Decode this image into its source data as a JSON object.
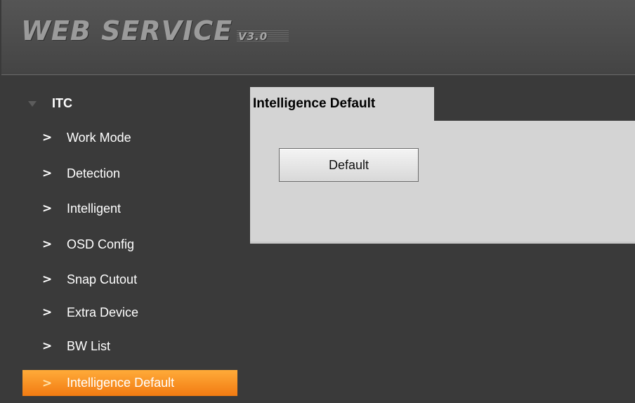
{
  "header": {
    "logo_text": "WEB SERVICE",
    "logo_version": "V3.0"
  },
  "sidebar": {
    "group_label": "ITC",
    "items": [
      {
        "label": "Work Mode",
        "icon": "chevron-right-icon"
      },
      {
        "label": "Detection",
        "icon": "chevron-right-icon"
      },
      {
        "label": "Intelligent",
        "icon": "chevron-right-icon"
      },
      {
        "label": "OSD Config",
        "icon": "chevron-right-icon"
      },
      {
        "label": "Snap Cutout",
        "icon": "chevron-right-icon"
      },
      {
        "label": "Extra Device",
        "icon": "chevron-right-icon"
      },
      {
        "label": "BW List",
        "icon": "chevron-right-icon"
      },
      {
        "label": "Intelligence Default",
        "icon": "chevron-right-icon",
        "active": true
      }
    ]
  },
  "main": {
    "title": "Intelligence Default",
    "default_button_label": "Default"
  },
  "colors": {
    "background": "#3a3a3a",
    "header": "#4b4b4b",
    "panel": "#d4d4d4",
    "active_start": "#ffab39",
    "active_end": "#f27b12"
  }
}
